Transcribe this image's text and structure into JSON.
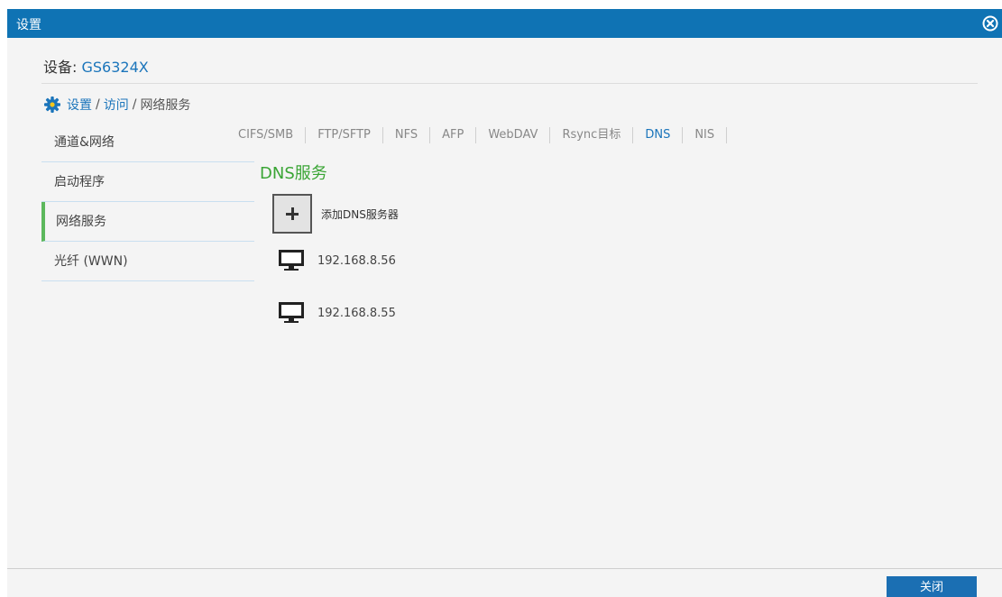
{
  "window": {
    "title": "设置",
    "close_icon": "close-circle-icon"
  },
  "device": {
    "label": "设备:",
    "name": "GS6324X"
  },
  "breadcrumb": {
    "icon": "gear-icon",
    "items": [
      "设置",
      "访问",
      "网络服务"
    ],
    "separator": "/"
  },
  "sidebar": {
    "items": [
      {
        "label": "通道&网络"
      },
      {
        "label": "启动程序"
      },
      {
        "label": "网络服务",
        "active": true
      },
      {
        "label": "光纤 (WWN)"
      }
    ]
  },
  "tabs": [
    {
      "label": "CIFS/SMB"
    },
    {
      "label": "FTP/SFTP"
    },
    {
      "label": "NFS"
    },
    {
      "label": "AFP"
    },
    {
      "label": "WebDAV"
    },
    {
      "label": "Rsync目标"
    },
    {
      "label": "DNS",
      "active": true
    },
    {
      "label": "NIS"
    }
  ],
  "section": {
    "title": "DNS服务"
  },
  "add_server": {
    "label": "添加DNS服务器",
    "icon": "plus-icon"
  },
  "servers": [
    {
      "ip": "192.168.8.56",
      "icon": "monitor-icon"
    },
    {
      "ip": "192.168.8.55",
      "icon": "monitor-icon"
    }
  ],
  "footer": {
    "close_label": "关闭"
  },
  "colors": {
    "titlebar": "#0f73b4",
    "link": "#1b75bb",
    "accent_green": "#3aa535",
    "active_bar": "#5cb85c"
  }
}
